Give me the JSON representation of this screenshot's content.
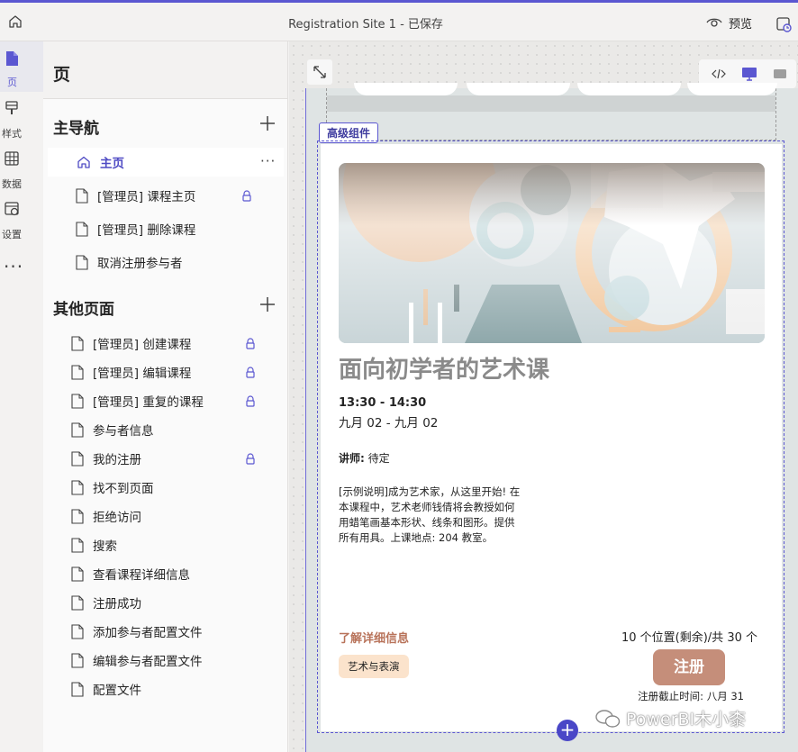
{
  "topbar": {
    "title": "Registration Site 1 - 已保存",
    "preview_label": "预览"
  },
  "rail": {
    "items": [
      {
        "label": "页",
        "icon": "page-icon"
      },
      {
        "label": "样式",
        "icon": "brush-icon"
      },
      {
        "label": "数据",
        "icon": "table-icon"
      },
      {
        "label": "设置",
        "icon": "settings-icon"
      }
    ],
    "more": "···"
  },
  "pages_panel": {
    "title": "页",
    "main_nav": {
      "title": "主导航",
      "items": [
        {
          "label": "主页",
          "icon": "home-icon",
          "selected": true,
          "more": "···"
        },
        {
          "label": "[管理员] 课程主页",
          "locked": true
        },
        {
          "label": "[管理员] 删除课程",
          "locked": false
        },
        {
          "label": "取消注册参与者",
          "locked": false
        }
      ]
    },
    "other_pages": {
      "title": "其他页面",
      "items": [
        {
          "label": "[管理员] 创建课程",
          "locked": true
        },
        {
          "label": "[管理员] 编辑课程",
          "locked": true
        },
        {
          "label": "[管理员] 重复的课程",
          "locked": true
        },
        {
          "label": "参与者信息",
          "locked": false
        },
        {
          "label": "我的注册",
          "locked": true
        },
        {
          "label": "找不到页面",
          "locked": false
        },
        {
          "label": "拒绝访问",
          "locked": false
        },
        {
          "label": "搜索",
          "locked": false
        },
        {
          "label": "查看课程详细信息",
          "locked": false
        },
        {
          "label": "注册成功",
          "locked": false
        },
        {
          "label": "添加参与者配置文件",
          "locked": false
        },
        {
          "label": "编辑参与者配置文件",
          "locked": false
        },
        {
          "label": "配置文件",
          "locked": false
        }
      ]
    }
  },
  "canvas": {
    "section_tag": "高级组件",
    "course": {
      "title": "面向初学者的艺术课",
      "time": "13:30 - 14:30",
      "date": "九月 02 - 九月 02",
      "instructor_label": "讲师:",
      "instructor_value": "待定",
      "description": "[示例说明]成为艺术家，从这里开始! 在本课程中，艺术老师钱倩将会教授如何用蜡笔画基本形状、线条和图形。提供所有用具。上课地点: 204 教室。",
      "learn_more": "了解详细信息",
      "seats": "10 个位置(剩余)/共 30 个",
      "category": "艺术与表演",
      "register": "注册",
      "deadline": "注册截止时间: 八月 31"
    },
    "add_symbol": "+",
    "watermark": "PowerBI木小桼"
  },
  "colors": {
    "accent": "#5b57d1",
    "register_button": "#c58e7a",
    "learn_more": "#b8735a",
    "chip": "#fbe3cc"
  }
}
